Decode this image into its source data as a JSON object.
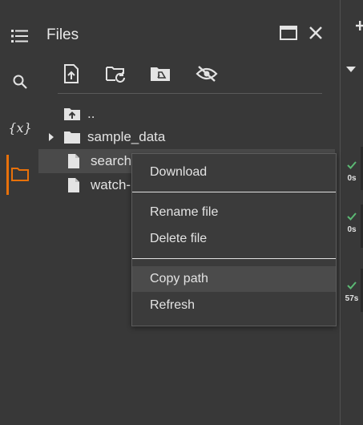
{
  "panel": {
    "title": "Files"
  },
  "rail": {
    "items": [
      {
        "name": "table-of-contents",
        "icon": "list-icon"
      },
      {
        "name": "search",
        "icon": "search-icon"
      },
      {
        "name": "variables",
        "icon": "variables-icon",
        "label": "{x}"
      },
      {
        "name": "files",
        "icon": "folder-icon",
        "active": true
      }
    ],
    "accent_color": "#e8710a"
  },
  "toolbar": {
    "buttons": [
      {
        "name": "upload-file",
        "icon": "upload-icon"
      },
      {
        "name": "refresh-folder",
        "icon": "folder-refresh-icon"
      },
      {
        "name": "mount-drive",
        "icon": "drive-folder-icon"
      },
      {
        "name": "toggle-hidden",
        "icon": "eye-off-icon"
      }
    ]
  },
  "tree": {
    "items": [
      {
        "label": "..",
        "icon": "folder-up-icon"
      },
      {
        "label": "sample_data",
        "icon": "folder-icon",
        "expandable": true
      },
      {
        "label": "search",
        "icon": "file-icon",
        "selected": true
      },
      {
        "label": "watch-",
        "icon": "file-icon"
      }
    ]
  },
  "context_menu": {
    "items": [
      {
        "label": "Download"
      },
      {
        "label": "Rename file"
      },
      {
        "label": "Delete file"
      },
      {
        "label": "Copy path",
        "hovered": true
      },
      {
        "label": "Refresh"
      }
    ]
  },
  "cells": [
    {
      "status": "done",
      "time": "0s"
    },
    {
      "status": "done",
      "time": "0s"
    },
    {
      "status": "done",
      "time": "57s"
    }
  ],
  "colors": {
    "success": "#5bb974",
    "background": "#383838"
  }
}
